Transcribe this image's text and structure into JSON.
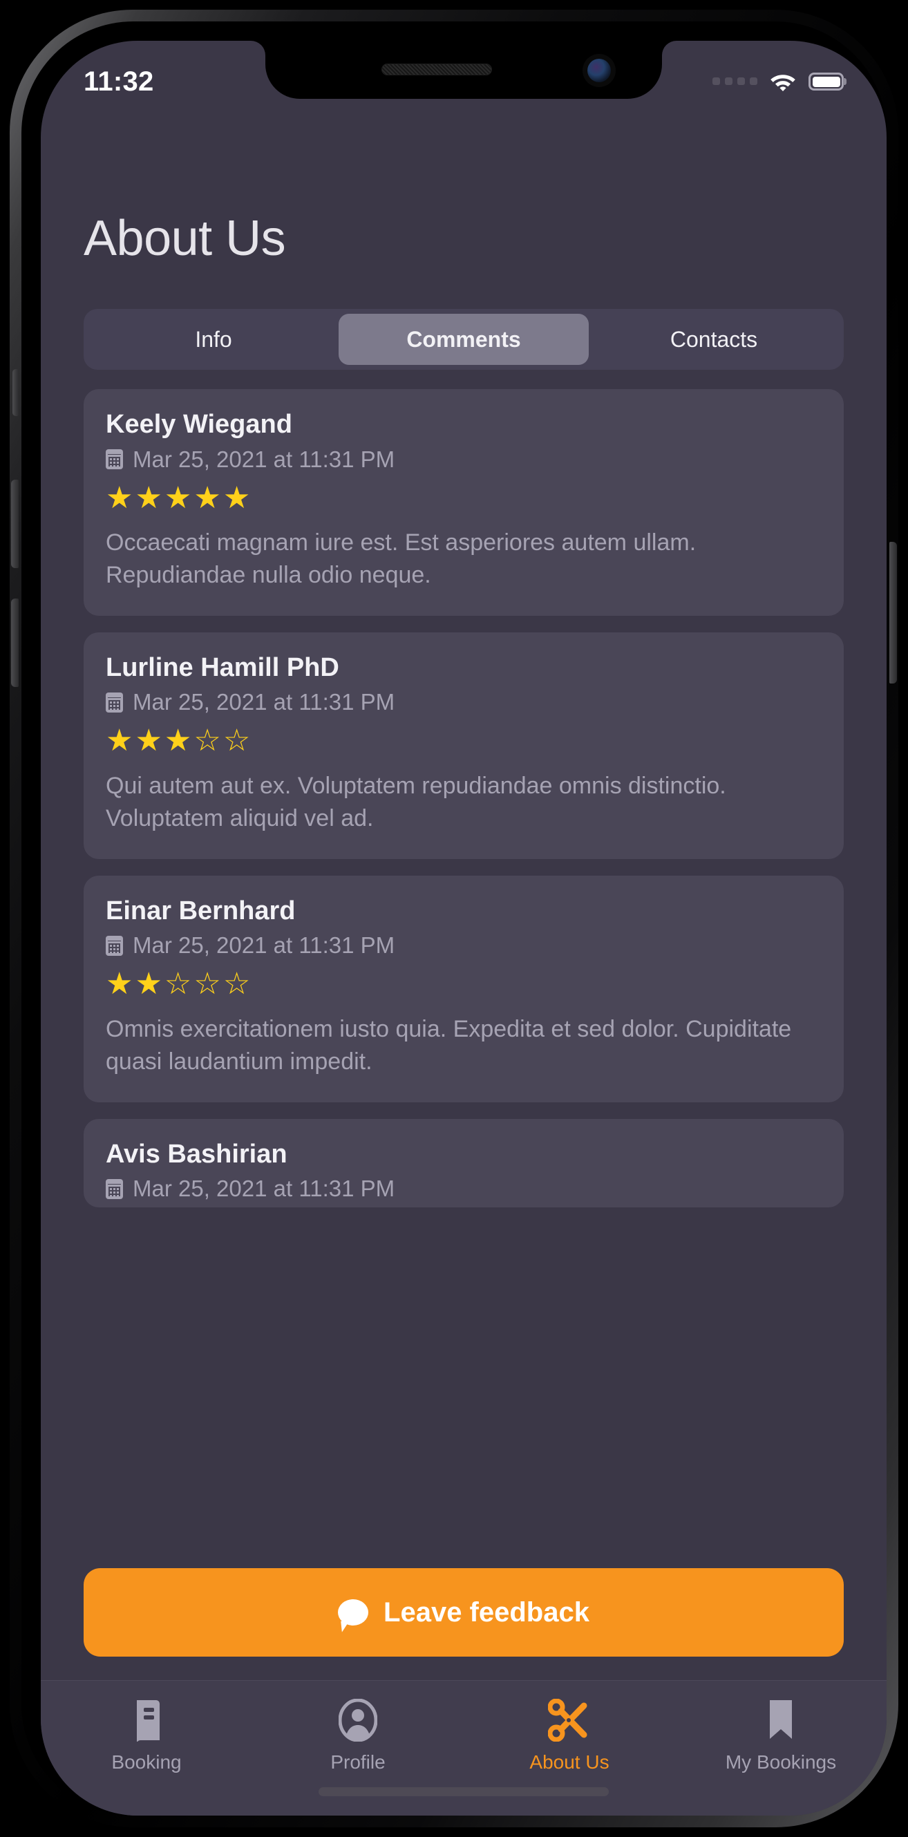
{
  "status_bar": {
    "time": "11:32",
    "signal_icon": "signal-dots-icon",
    "wifi_icon": "wifi-icon",
    "battery_icon": "battery-full-icon",
    "battery_level": "100"
  },
  "header": {
    "title": "About Us"
  },
  "segmented_control": {
    "selected": "Comments",
    "tabs": [
      {
        "label": "Info",
        "active": false
      },
      {
        "label": "Comments",
        "active": true
      },
      {
        "label": "Contacts",
        "active": false
      }
    ]
  },
  "reviews": [
    {
      "name": "Keely Wiegand",
      "date": "Mar 25, 2021 at 11:31 PM",
      "rating": 5,
      "max_rating": 5,
      "text": "Occaecati magnam iure est. Est asperiores autem ullam. Repudiandae nulla odio neque."
    },
    {
      "name": "Lurline Hamill PhD",
      "date": "Mar 25, 2021 at 11:31 PM",
      "rating": 3,
      "max_rating": 5,
      "text": "Qui autem aut ex. Voluptatem repudiandae omnis distinctio. Voluptatem aliquid vel ad."
    },
    {
      "name": "Einar Bernhard",
      "date": "Mar 25, 2021 at 11:31 PM",
      "rating": 2,
      "max_rating": 5,
      "text": "Omnis exercitationem iusto quia. Expedita et sed dolor. Cupiditate quasi laudantium impedit."
    },
    {
      "name": "Avis Bashirian",
      "date": "Mar 25, 2021 at 11:31 PM",
      "rating": 0,
      "max_rating": 5,
      "text": ""
    }
  ],
  "feedback_button": {
    "label": "Leave feedback",
    "icon": "speech-bubble-icon"
  },
  "tab_bar": {
    "items": [
      {
        "label": "Booking",
        "icon": "book-icon",
        "active": false
      },
      {
        "label": "Profile",
        "icon": "person-circle-icon",
        "active": false
      },
      {
        "label": "About Us",
        "icon": "scissors-icon",
        "active": true
      },
      {
        "label": "My Bookings",
        "icon": "bookmark-icon",
        "active": false
      }
    ]
  },
  "colors": {
    "screen_background": "#3b3747",
    "card_background": "#4a4657",
    "segment_track": "#454155",
    "segment_active": "#7d7a8c",
    "accent_orange": "#F7941E",
    "star_yellow": "#FFD11A",
    "muted_text": "#a6a3b3",
    "primary_text": "#f3f2f6",
    "tabbar_background": "#413d4e"
  },
  "glyphs": {
    "star_filled": "★",
    "star_empty": "☆"
  }
}
